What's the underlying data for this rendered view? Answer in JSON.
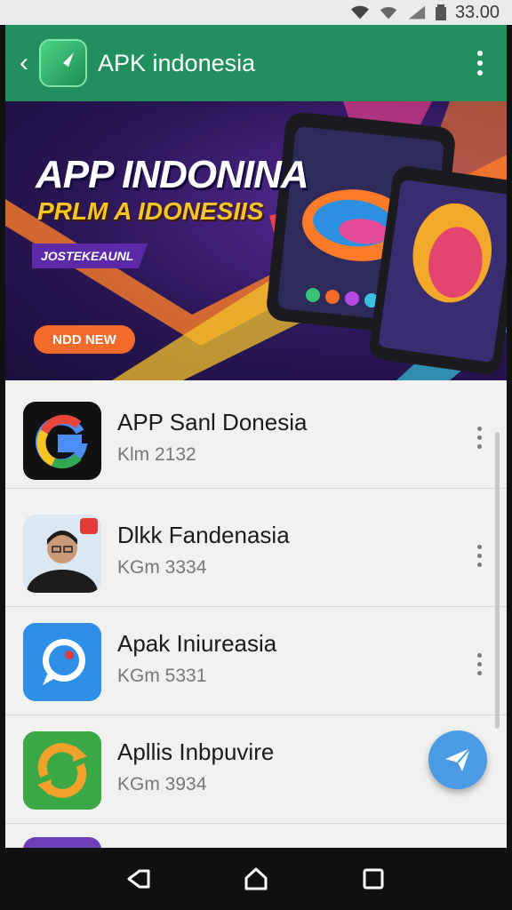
{
  "status_bar": {
    "time": "33.00"
  },
  "app_bar": {
    "title": "APK indonesia"
  },
  "banner": {
    "title": "APP INDONINA",
    "subtitle": "PRLM A IDONESIIS",
    "tag": "JOSTEKEAUNL",
    "cta": "NDD NEW"
  },
  "apps": [
    {
      "name": "APP Sanl Donesia",
      "meta": "Klm 2132",
      "icon": "google-g-icon"
    },
    {
      "name": "Dlkk Fandenasia",
      "meta": "KGm 3334",
      "icon": "person-photo-icon"
    },
    {
      "name": "Apak Iniureasia",
      "meta": "KGm 5331",
      "icon": "chat-bubble-icon"
    },
    {
      "name": "Apllis Inbpuvire",
      "meta": "KGm 3934",
      "icon": "refresh-orange-icon"
    }
  ],
  "colors": {
    "app_bar": "#21905e",
    "fab": "#4a9be3",
    "cta": "#f36b2a"
  }
}
